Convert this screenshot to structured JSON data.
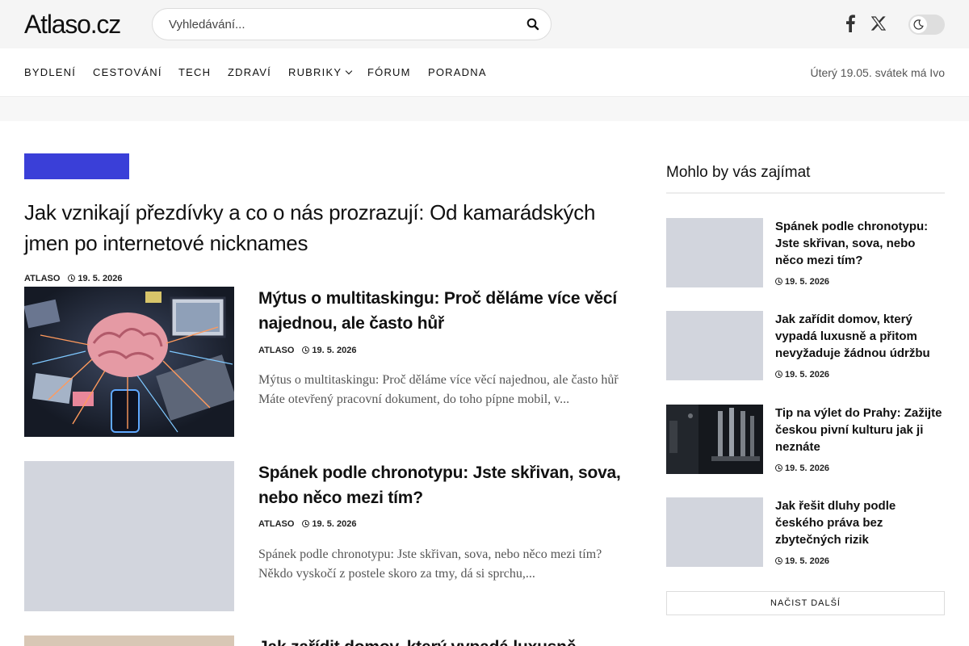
{
  "header": {
    "logo": "Atlaso.cz",
    "search_placeholder": "Vyhledávání...",
    "icons": [
      "search-icon",
      "facebook-icon",
      "x-icon",
      "moon-icon"
    ]
  },
  "nav": {
    "items": [
      "BYDLENÍ",
      "CESTOVÁNÍ",
      "TECH",
      "ZDRAVÍ",
      "RUBRIKY",
      "FÓRUM",
      "PORADNA"
    ],
    "date_text": "Úterý 19.05. svátek má Ivo"
  },
  "hero": {
    "title": "Jak vznikají přezdívky a co o nás prozrazují: Od kamarádských jmen po internetové nicknames",
    "author": "ATLASO",
    "date": "19. 5. 2026"
  },
  "articles": [
    {
      "title": "Mýtus o multitaskingu: Proč děláme více věcí najednou, ale často hůř",
      "author": "ATLASO",
      "date": "19. 5. 2026",
      "excerpt": "Mýtus o multitaskingu: Proč děláme více věcí najednou, ale často hůř Máte otevřený pracovní dokument, do toho pípne mobil, v..."
    },
    {
      "title": "Spánek podle chronotypu: Jste skřivan, sova, nebo něco mezi tím?",
      "author": "ATLASO",
      "date": "19. 5. 2026",
      "excerpt": "Spánek podle chronotypu: Jste skřivan, sova, nebo něco mezi tím? Někdo vyskočí z postele skoro za tmy, dá si sprchu,..."
    },
    {
      "title": "Jak zařídit domov, který vypadá luxusně"
    }
  ],
  "sidebar": {
    "heading": "Mohlo by vás zajímat",
    "items": [
      {
        "title": "Spánek podle chronotypu: Jste skřivan, sova, nebo něco mezi tím?",
        "date": "19. 5. 2026"
      },
      {
        "title": "Jak zařídit domov, který vypadá luxusně a přitom nevyžaduje žádnou údržbu",
        "date": "19. 5. 2026"
      },
      {
        "title": "Tip na výlet do Prahy: Zažijte českou pivní kulturu jak ji neznáte",
        "date": "19. 5. 2026"
      },
      {
        "title": "Jak řešit dluhy podle českého práva bez zbytečných rizik",
        "date": "19. 5. 2026"
      }
    ],
    "load_more": "NAČIST DALŠÍ"
  },
  "colors": {
    "accent": "#3a3fd8",
    "topbar_bg": "#f5f5f5",
    "placeholder": "#d2d5dd"
  }
}
